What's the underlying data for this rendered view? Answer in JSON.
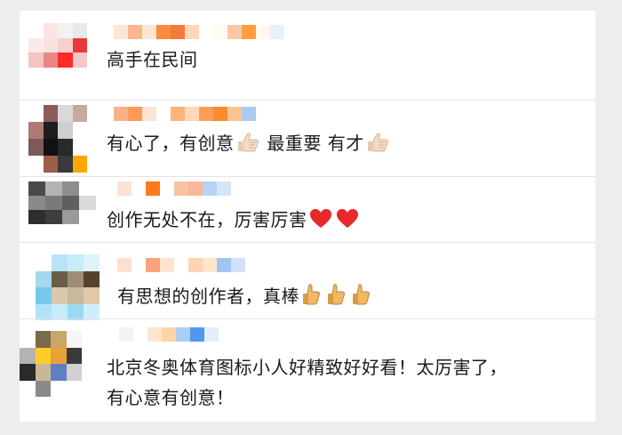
{
  "comments": [
    {
      "avatar_colors": [
        "#ffffff",
        "#fbe4e4",
        "#f2f2f2",
        "#e8e8e8",
        "#fde8e8",
        "#fbe0e0",
        "#f7d0d0",
        "#e83a3a",
        "#f4c4c4",
        "#e98686",
        "#ff2b2b",
        "#f4c8c8",
        "#ffffff",
        "#ffffff",
        "#ffffff",
        "#ffffff"
      ],
      "nick_colors": [
        "#fce6d8",
        "#f7b88e",
        "#fde6d6",
        "#ff8a3d",
        "#f47a3a",
        "#ffd7b8",
        "#ffffff",
        "#fffaf2",
        "#f8c9a8",
        "#ff9d42",
        "#fff7ef",
        "#e6f1fb"
      ],
      "text": "高手在民间",
      "emoji": []
    },
    {
      "avatar_colors": [
        "#ffffff",
        "#8e5c58",
        "#d9d9d9",
        "#c8a9a2",
        "#b07a72",
        "#1e1e1e",
        "#cfcfcf",
        "#ffffff",
        "#7a5a5a",
        "#111111",
        "#2a2a2a",
        "#ffffff",
        "#ffffff",
        "#9a5e4a",
        "#3a3a3a",
        "#ffa500"
      ],
      "nick_colors": [
        "#f7b28a",
        "#ff9a5a",
        "#fde4d2",
        "#ffffff",
        "#ffb27a",
        "#fed8bc",
        "#ff9d57",
        "#ff8a2c",
        "#ffc48f",
        "#a9cbf1"
      ],
      "text_parts": [
        "有心了，有创意",
        "最重要 有才"
      ],
      "emoji": [
        "thumbs-up",
        "thumbs-up"
      ]
    },
    {
      "avatar_colors": [
        "#4a4a4a",
        "#b4b4b4",
        "#8d8d8d",
        "#ffffff",
        "#8a8a8a",
        "#7a7a7a",
        "#5f5f5f",
        "#d9d9d9",
        "#2e2e2e",
        "#3d3d3d",
        "#9a9a9a",
        "#ffffff",
        "#ffffff",
        "#ffffff",
        "#ffffff",
        "#ffffff"
      ],
      "nick_colors": [
        "#fbe3d3",
        "#ffffff",
        "#ff7a1a",
        "#ffffff",
        "#f6c3a4",
        "#fbb79a",
        "#b6d4f2",
        "#d5e6f8"
      ],
      "text": "创作无处不在，厉害厉害",
      "emoji": [
        "red-heart",
        "red-heart"
      ]
    },
    {
      "avatar_colors": [
        "#ffffff",
        "#b8e4f7",
        "#c7ecfa",
        "#e0f3f9",
        "#a5d8ef",
        "#6a5e44",
        "#9f8c74",
        "#55422e",
        "#76c7ec",
        "#d9c8aa",
        "#c7b8a0",
        "#e0c8aa",
        "#b3e2f6",
        "#c7ecfa",
        "#9bd8f3",
        "#d0eefa"
      ],
      "nick_colors": [
        "#fde0d0",
        "#ffffff",
        "#f7a47a",
        "#ffe3cf",
        "#ffffff",
        "#ffd3b5",
        "#ffe6cd",
        "#9fc6f2",
        "#cfe2f7"
      ],
      "text": "有思想的创作者，真棒",
      "emoji": [
        "thumbs-up-tan",
        "thumbs-up-tan",
        "thumbs-up-tan"
      ]
    },
    {
      "avatar_colors": [
        "#ffffff",
        "#7a6a4a",
        "#caa66a",
        "#f5f5f5",
        "#b3b3b3",
        "#ffcc2a",
        "#e8a23c",
        "#3a3a3a",
        "#2a2a2a",
        "#c8b89a",
        "#5f7fbf",
        "#d0d0d0",
        "#ffffff",
        "#8a8a8a",
        "#ffffff",
        "#ffffff"
      ],
      "nick_colors": [
        "#f3f3f3",
        "#ffffff",
        "#fde5d2",
        "#ffd4a4",
        "#a9cff3",
        "#4f9aee",
        "#e4eefa"
      ],
      "text_line1": "北京冬奥体育图标小人好精致好好看！太厉害了，",
      "text_line2": "有心意有创意！",
      "emoji": []
    }
  ]
}
